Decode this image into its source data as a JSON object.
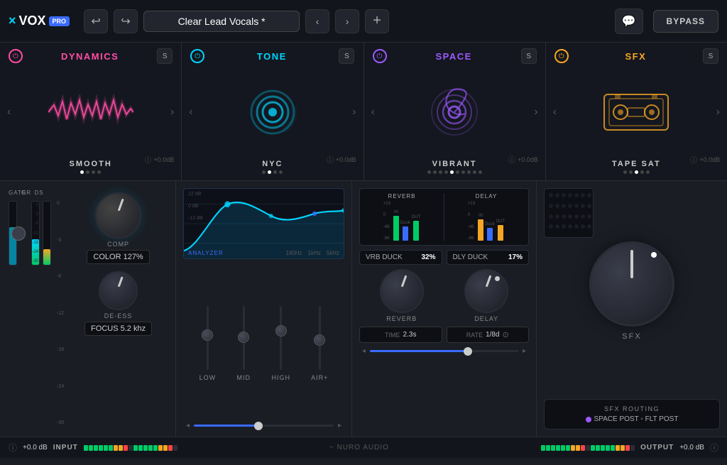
{
  "app": {
    "logo_x": "×",
    "logo_vox": "VOX",
    "logo_pro": "PRO"
  },
  "header": {
    "back_label": "↩",
    "forward_label": "↪",
    "preset_name": "Clear Lead Vocals *",
    "prev_label": "‹",
    "next_label": "›",
    "add_label": "+",
    "chat_label": "💬",
    "bypass_label": "BYPASS"
  },
  "modules": [
    {
      "id": "dynamics",
      "title": "DYNAMICS",
      "preset": "SMOOTH",
      "db": "+0.0dB",
      "dots": 4,
      "active_dot": 1
    },
    {
      "id": "tone",
      "title": "TONE",
      "preset": "NYC",
      "db": "+0.0dB",
      "dots": 4,
      "active_dot": 2
    },
    {
      "id": "space",
      "title": "SPACE",
      "preset": "VIBRANT",
      "db": "+0.0dB",
      "dots": 10,
      "active_dot": 5
    },
    {
      "id": "sfx",
      "title": "SFX",
      "preset": "TAPE SAT",
      "db": "+0.0dB",
      "dots": 5,
      "active_dot": 3
    }
  ],
  "dynamics_panel": {
    "labels": [
      "GATE",
      "GR",
      "DS"
    ],
    "comp_label": "COMP",
    "comp_color": "COLOR 127%",
    "de_ess_label": "DE-ESS",
    "de_ess_focus": "FOCUS 5.2 khz"
  },
  "tone_panel": {
    "analyzer_label": "ANALYZER",
    "freqs": [
      "180Hz",
      "1kHz",
      "5kHz"
    ],
    "db_labels": [
      "12 dB",
      "0 dB",
      "-12 dB"
    ],
    "eq_bands": [
      {
        "label": "LOW",
        "position": 50
      },
      {
        "label": "MID",
        "position": 45
      },
      {
        "label": "HIGH",
        "position": 55
      },
      {
        "label": "AIR+",
        "position": 40
      }
    ]
  },
  "space_panel": {
    "reverb_label": "REVERB",
    "delay_label": "DELAY",
    "vrb_duck_label": "VRB DUCK",
    "vrb_duck_value": "32%",
    "dly_duck_label": "DLY DUCK",
    "dly_duck_value": "17%",
    "reverb_knob_label": "REVERB",
    "delay_knob_label": "DELAY",
    "time_label": "TIME",
    "time_value": "2.3s",
    "rate_label": "RATE",
    "rate_value": "1/8d"
  },
  "sfx_panel": {
    "label": "SFX",
    "routing_title": "SFX ROUTING",
    "routing_value": "SPACE POST ◦ FLT POST"
  },
  "bottom": {
    "input_db": "+0.0 dB",
    "input_label": "INPUT",
    "brand": "~ NURO AUDIO",
    "output_label": "OUTPUT",
    "output_db": "+0.0 dB"
  }
}
